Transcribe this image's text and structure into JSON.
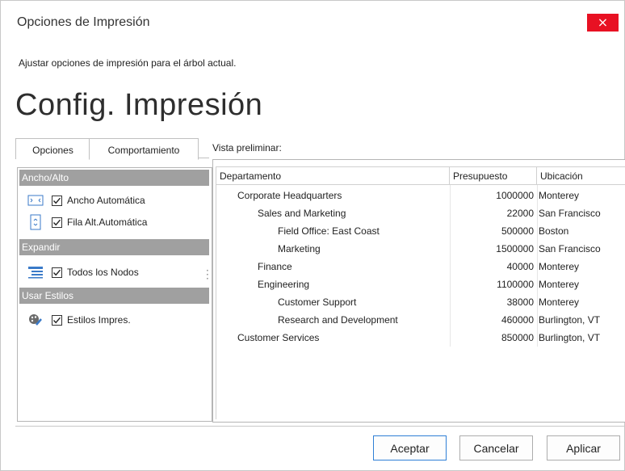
{
  "window": {
    "title": "Opciones de Impresión",
    "close_glyph": "×",
    "description": "Ajustar opciones de impresión para el árbol actual.",
    "heading": "Config. Impresión"
  },
  "tabs": [
    {
      "label": "Opciones",
      "active": false
    },
    {
      "label": "Comportamiento",
      "active": true
    }
  ],
  "groups": [
    {
      "header": "Ancho/Alto",
      "options": [
        {
          "icon": "resize-width-icon",
          "label": "Ancho Automática",
          "checked": true
        },
        {
          "icon": "resize-height-icon",
          "label": "Fila Alt.Automática",
          "checked": true
        }
      ]
    },
    {
      "header": "Expandir",
      "options": [
        {
          "icon": "list-expand-icon",
          "label": "Todos los Nodos",
          "checked": true
        }
      ]
    },
    {
      "header": "Usar Estilos",
      "options": [
        {
          "icon": "palette-icon",
          "label": "Estilos Impres.",
          "checked": true
        }
      ]
    }
  ],
  "preview": {
    "label": "Vista preliminar:",
    "columns": [
      "Departamento",
      "Presupuesto",
      "Ubicación"
    ],
    "rows": [
      {
        "level": 1,
        "department": "Corporate Headquarters",
        "budget": "1000000",
        "location": "Monterey"
      },
      {
        "level": 2,
        "department": "Sales and Marketing",
        "budget": "22000",
        "location": "San Francisco"
      },
      {
        "level": 3,
        "department": "Field Office: East Coast",
        "budget": "500000",
        "location": "Boston"
      },
      {
        "level": 3,
        "department": "Marketing",
        "budget": "1500000",
        "location": "San Francisco"
      },
      {
        "level": 2,
        "department": "Finance",
        "budget": "40000",
        "location": "Monterey"
      },
      {
        "level": 2,
        "department": "Engineering",
        "budget": "1100000",
        "location": "Monterey"
      },
      {
        "level": 3,
        "department": "Customer Support",
        "budget": "38000",
        "location": "Monterey"
      },
      {
        "level": 3,
        "department": "Research and Development",
        "budget": "460000",
        "location": "Burlington, VT"
      },
      {
        "level": 1,
        "department": "Customer Services",
        "budget": "850000",
        "location": "Burlington, VT"
      }
    ]
  },
  "buttons": {
    "accept": "Aceptar",
    "cancel": "Cancelar",
    "apply": "Aplicar"
  },
  "colors": {
    "close_bg": "#e81123",
    "group_header_bg": "#a0a0a0",
    "primary_border": "#2f7fd6"
  }
}
